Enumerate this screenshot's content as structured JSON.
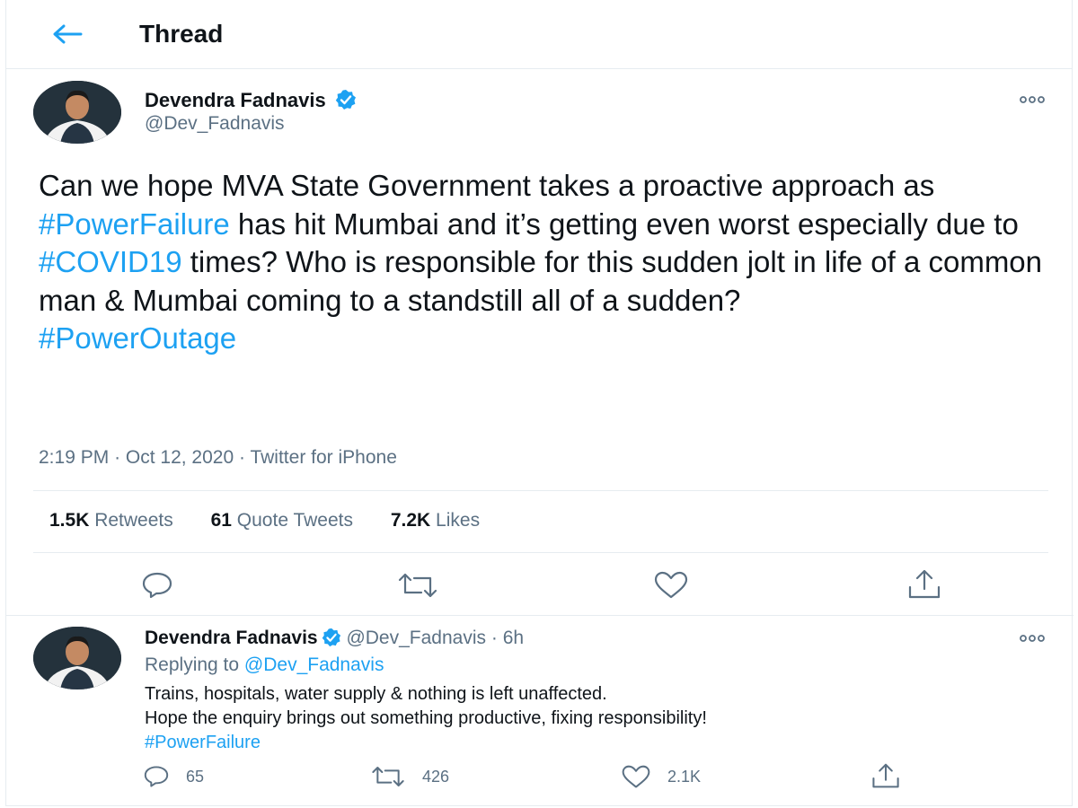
{
  "header": {
    "title": "Thread",
    "back_icon": "arrow-left-icon"
  },
  "colors": {
    "accent": "#1da1f2",
    "text": "#0f1419",
    "muted": "#5b7083",
    "border": "#e6ecf0"
  },
  "main_tweet": {
    "author_name": "Devendra Fadnavis",
    "handle": "@Dev_Fadnavis",
    "text_parts": [
      "Can we hope MVA State Government takes a proactive approach as ",
      "#PowerFailure",
      " has hit Mumbai and it’s getting even worst especially due to ",
      "#COVID19",
      " times? Who is responsible for this sudden jolt in life of a common man & Mumbai coming to a standstill all of a sudden?",
      "#PowerOutage"
    ],
    "time": "2:19 PM",
    "date": "Oct 12, 2020",
    "source": "Twitter for iPhone",
    "separator": "·",
    "stats": {
      "retweets_count": "1.5K",
      "retweets_label": "Retweets",
      "quotes_count": "61",
      "quotes_label": "Quote Tweets",
      "likes_count": "7.2K",
      "likes_label": "Likes"
    }
  },
  "reply_tweet": {
    "author_name": "Devendra Fadnavis",
    "handle": "@Dev_Fadnavis",
    "separator": "·",
    "time_ago": "6h",
    "replying_prefix": "Replying to ",
    "replying_handle": "@Dev_Fadnavis",
    "line1": "Trains, hospitals, water supply & nothing is left unaffected.",
    "line2": "Hope the enquiry brings out something productive, fixing responsibility!",
    "hashtag": "#PowerFailure",
    "counts": {
      "replies": "65",
      "retweets": "426",
      "likes": "2.1K"
    }
  }
}
